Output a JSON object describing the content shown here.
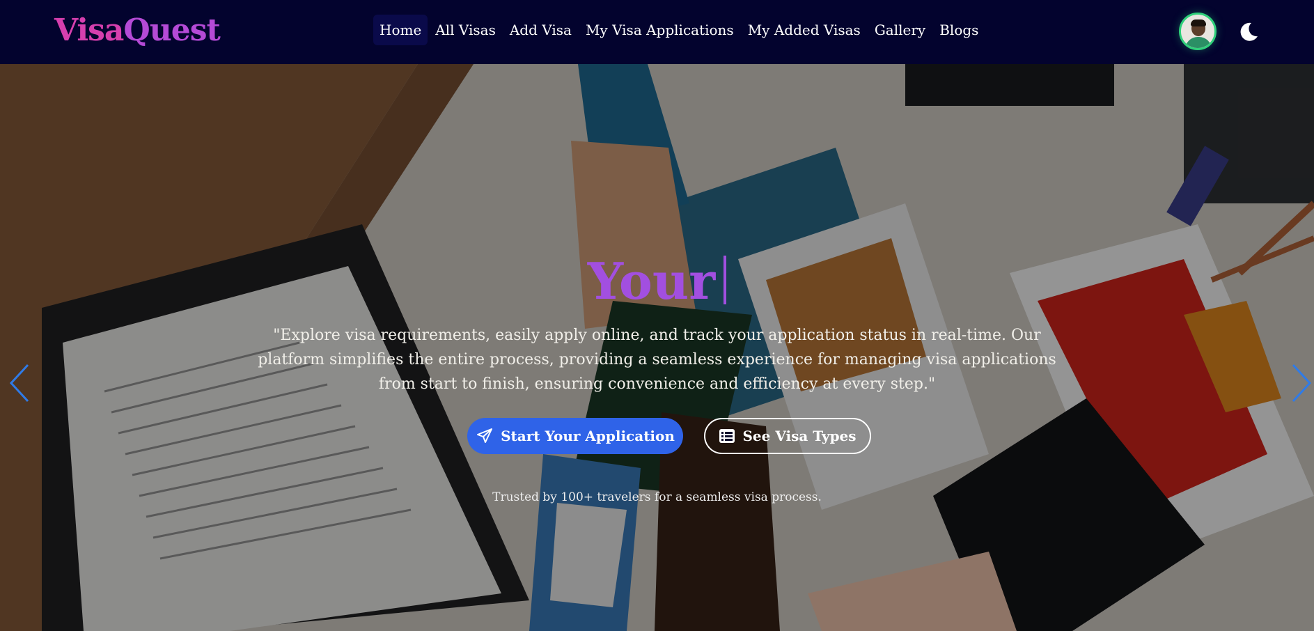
{
  "brand": {
    "name_part1": "Visa",
    "name_part2": "Quest"
  },
  "nav": {
    "links": [
      {
        "label": "Home",
        "active": true
      },
      {
        "label": "All Visas"
      },
      {
        "label": "Add Visa"
      },
      {
        "label": "My Visa Applications"
      },
      {
        "label": "My Added Visas"
      },
      {
        "label": "Gallery"
      },
      {
        "label": "Blogs"
      }
    ],
    "avatar_icon": "user-avatar",
    "theme_icon": "moon-icon"
  },
  "hero": {
    "heading": "Your",
    "description": "\"Explore visa requirements, easily apply online, and track your application status in real-time. Our platform simplifies the entire process, providing a seamless experience for managing visa applications from start to finish, ensuring convenience and efficiency at every step.\"",
    "primary_button": {
      "label": "Start Your Application",
      "icon": "paper-plane-icon"
    },
    "secondary_button": {
      "label": "See Visa Types",
      "icon": "list-icon"
    },
    "trusted_text": "Trusted by 100+ travelers for a seamless visa process.",
    "prev_icon": "chevron-left-icon",
    "next_icon": "chevron-right-icon"
  },
  "colors": {
    "navbar_bg": "#03032e",
    "logo": "#d63fae",
    "heading": "#a24fe0",
    "primary_button": "#2f63e8",
    "carousel_arrow": "#2f7be8"
  }
}
